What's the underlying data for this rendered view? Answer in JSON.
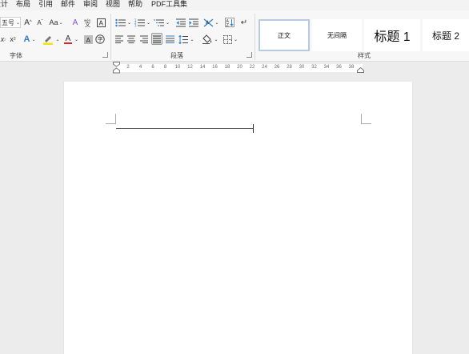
{
  "menu_tabs": [
    "设计",
    "布局",
    "引用",
    "邮件",
    "审阅",
    "视图",
    "帮助",
    "PDF工具集"
  ],
  "font": {
    "size_value": "五号",
    "grow_label": "A",
    "shrink_label": "A",
    "case_label": "Aa",
    "clear_label": "A",
    "text_effect_label": "A",
    "font_color_label": "A",
    "group_label": "字体",
    "font_color": "#d9262c",
    "highlight_color": "#f5e400"
  },
  "paragraph": {
    "group_label": "段落",
    "sort_label": "A↓"
  },
  "styles": {
    "group_label": "样式",
    "items": [
      "正文",
      "无间隔",
      "标题 1",
      "标题 2"
    ]
  },
  "ruler": {
    "numbers": [
      "2",
      "4",
      "6",
      "8",
      "10",
      "12",
      "14",
      "16",
      "18",
      "20",
      "22",
      "24",
      "26",
      "28",
      "30",
      "32",
      "34",
      "36",
      "38"
    ]
  }
}
